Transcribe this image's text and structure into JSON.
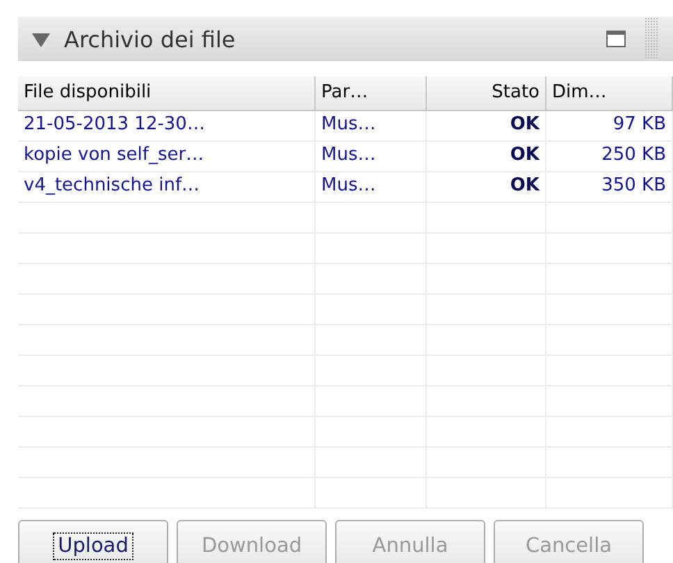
{
  "panel": {
    "title": "Archivio dei file",
    "expanded": true
  },
  "table": {
    "columns": [
      "File disponibili",
      "Par…",
      "Stato",
      "Dim…"
    ],
    "rows": [
      {
        "file": "21-05-2013 12-30…",
        "part": "Mus…",
        "status": "OK",
        "size": "97 KB"
      },
      {
        "file": "kopie von self_ser…",
        "part": "Mus…",
        "status": "OK",
        "size": "250 KB"
      },
      {
        "file": "v4_technische inf…",
        "part": "Mus…",
        "status": "OK",
        "size": "350 KB"
      }
    ]
  },
  "buttons": [
    {
      "label": "Upload",
      "disabled": false,
      "focused": true
    },
    {
      "label": "Download",
      "disabled": true,
      "focused": false
    },
    {
      "label": "Annulla",
      "disabled": true,
      "focused": false
    },
    {
      "label": "Cancella",
      "disabled": true,
      "focused": false
    }
  ]
}
